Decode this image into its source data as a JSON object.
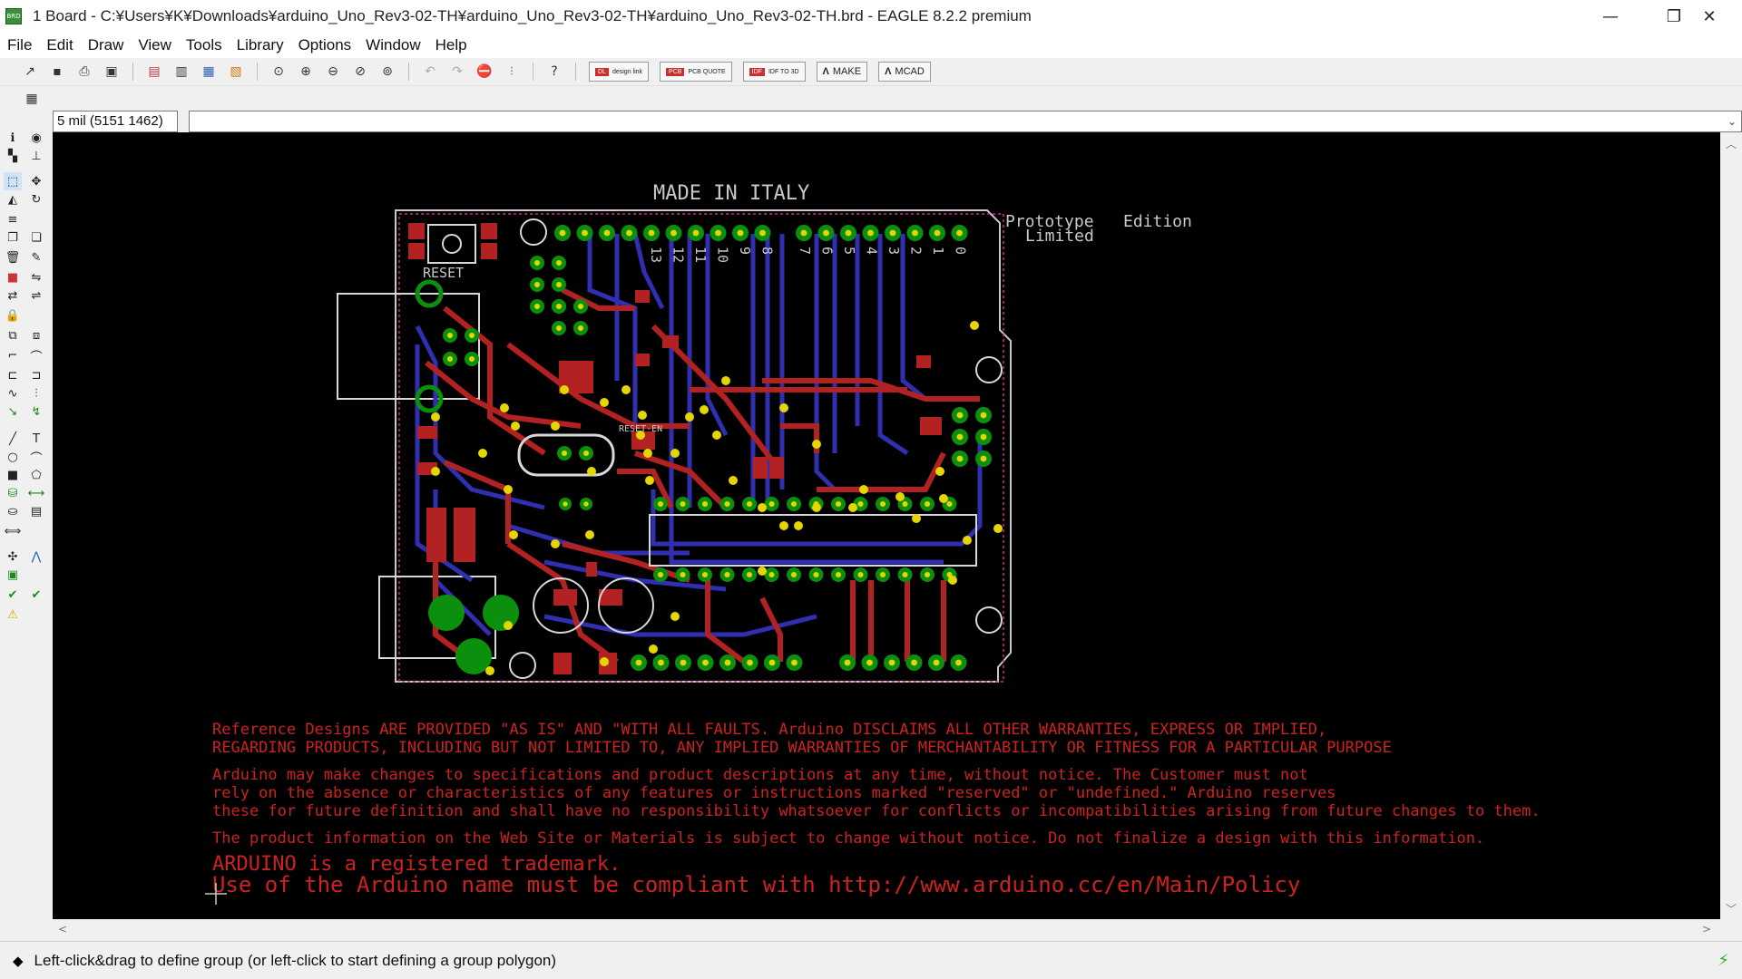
{
  "window": {
    "title": "1 Board - C:¥Users¥K¥Downloads¥arduino_Uno_Rev3-02-TH¥arduino_Uno_Rev3-02-TH¥arduino_Uno_Rev3-02-TH.brd - EAGLE 8.2.2 premium",
    "app_icon": "BRD",
    "minimize": "—",
    "restore": "❐",
    "close": "✕"
  },
  "menu": [
    "File",
    "Edit",
    "Draw",
    "View",
    "Tools",
    "Library",
    "Options",
    "Window",
    "Help"
  ],
  "toolbar": {
    "design_link": "design link",
    "pcb_quote": "PCB QUOTE",
    "idf": "IDF TO 3D",
    "make": "MAKE",
    "mcad": "MCAD"
  },
  "command": {
    "coord": "5 mil (5151 1462)",
    "input": ""
  },
  "board": {
    "made_label": "MADE IN ITALY",
    "prototype_label": "Prototype",
    "limited_label": "Limited",
    "edition_label": "Edition",
    "reset_label": "RESET",
    "reset_en_label": "RESET-EN",
    "pin_numbers_left": [
      "13",
      "12",
      "11",
      "10",
      "9",
      "8"
    ],
    "pin_numbers_right": [
      "7",
      "6",
      "5",
      "4",
      "3",
      "2",
      "1",
      "0"
    ]
  },
  "disclaimer": {
    "line1": "Reference Designs ARE PROVIDED \"AS IS\" AND \"WITH ALL FAULTS. Arduino DISCLAIMS ALL OTHER WARRANTIES, EXPRESS OR IMPLIED,",
    "line2": "REGARDING PRODUCTS, INCLUDING BUT NOT LIMITED TO, ANY IMPLIED WARRANTIES OF MERCHANTABILITY OR FITNESS FOR A PARTICULAR PURPOSE",
    "line3": "Arduino may make changes to specifications and product descriptions at any time, without notice. The Customer must not",
    "line4": "rely on the absence or characteristics of any features or instructions marked \"reserved\" or \"undefined.\" Arduino reserves",
    "line5": "these for future definition and shall have no responsibility whatsoever for conflicts or incompatibilities arising from future changes to them.",
    "line6": "The product information on the Web Site or Materials is subject to change without notice. Do not finalize a design with this information.",
    "line7": "ARDUINO is a registered trademark.",
    "line8": "Use of the Arduino name must be compliant with http://www.arduino.cc/en/Main/Policy"
  },
  "status": {
    "icon": "diamond-icon",
    "text": "Left-click&drag to define group (or left-click to start defining a group polygon)"
  },
  "colors": {
    "canvas": "#000000",
    "top_copper": "#b22222",
    "bottom_copper": "#2f2fb0",
    "pad": "#0c8f0c",
    "via": "#e6d600",
    "silk": "#d8d8d8",
    "dimension": "#c8c8c8",
    "disclaimer_text": "#cc2222"
  }
}
